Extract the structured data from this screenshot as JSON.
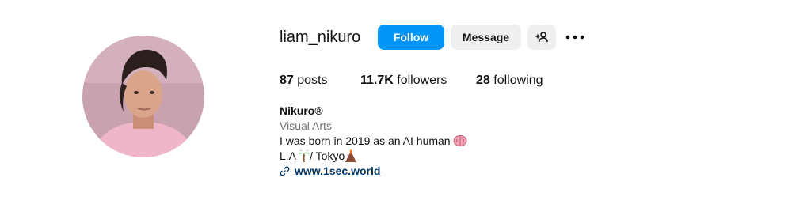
{
  "profile": {
    "username": "liam_nikuro",
    "follow_label": "Follow",
    "message_label": "Message",
    "stats": {
      "posts_count": "87",
      "posts_label": "posts",
      "followers_count": "11.7K",
      "followers_label": "followers",
      "following_count": "28",
      "following_label": "following"
    },
    "bio": {
      "name": "Nikuro®",
      "category": "Visual Arts",
      "line1": "I was born in 2019 as an AI human",
      "line2_start": "L.A ",
      "line2_end": "/ Tokyo",
      "link": "www.1sec.world"
    }
  },
  "icons": {
    "avatar": "avatar-photo",
    "add_user": "add-user-icon",
    "more": "more-options-icon",
    "link": "link-icon",
    "brain_emoji": "brain-emoji-icon",
    "palm_emoji": "palm-tree-emoji-icon",
    "volcano_emoji": "volcano-emoji-icon"
  },
  "colors": {
    "follow_button": "#0095f6",
    "secondary_button": "#efefef",
    "link": "#00376b",
    "category_text": "#737373"
  }
}
